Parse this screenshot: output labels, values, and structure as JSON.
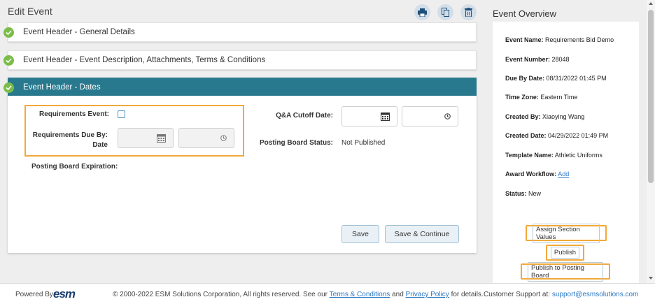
{
  "page": {
    "title": "Edit Event"
  },
  "toolbar": {
    "icons": [
      "print-icon",
      "copy-icon",
      "trash-icon"
    ]
  },
  "accordions": [
    {
      "title": "Event Header - General Details"
    },
    {
      "title": "Event Header - Event Description, Attachments, Terms & Conditions"
    },
    {
      "title": "Event Header - Dates"
    }
  ],
  "dates": {
    "requirements_event_label": "Requirements Event:",
    "requirements_due_label_1": "Requirements Due By:",
    "requirements_due_label_2": "Date",
    "qa_cutoff_label": "Q&A Cutoff Date:",
    "posting_board_status_label": "Posting Board Status:",
    "posting_board_status_value": "Not Published",
    "posting_board_expiration_label": "Posting Board Expiration:",
    "save_label": "Save",
    "save_continue_label": "Save & Continue"
  },
  "overview": {
    "title": "Event Overview",
    "rows": [
      {
        "label": "Event Name:",
        "value": "Requirements Bid Demo"
      },
      {
        "label": "Event Number:",
        "value": "28048"
      },
      {
        "label": "Due By Date:",
        "value": "08/31/2022 01:45 PM"
      },
      {
        "label": "Time Zone:",
        "value": "Eastern Time"
      },
      {
        "label": "Created By:",
        "value": "Xiaoying Wang"
      },
      {
        "label": "Created Date:",
        "value": "04/29/2022 01:49 PM"
      },
      {
        "label": "Template Name:",
        "value": "Athletic Uniforms"
      },
      {
        "label": "Award Workflow:",
        "value": "Add"
      },
      {
        "label": "Status:",
        "value": "New"
      }
    ],
    "buttons": {
      "assign": "Assign Section Values",
      "publish": "Publish",
      "publish_posting": "Publish to Posting Board"
    }
  },
  "footer": {
    "powered_by": "Powered By:",
    "logo": "esm",
    "copyright": "© 2000-2022 ESM Solutions Corporation, All rights reserved. See our",
    "terms": "Terms & Conditions",
    "and": "and",
    "privacy": "Privacy Policy",
    "for_details": "for details.",
    "support_label": "Customer Support at:",
    "support_email": "support@esmsolutions.com"
  },
  "colors": {
    "accent": "#29798e",
    "highlight": "#f2a93a",
    "check": "#7bbd49",
    "link": "#2a77c3"
  }
}
